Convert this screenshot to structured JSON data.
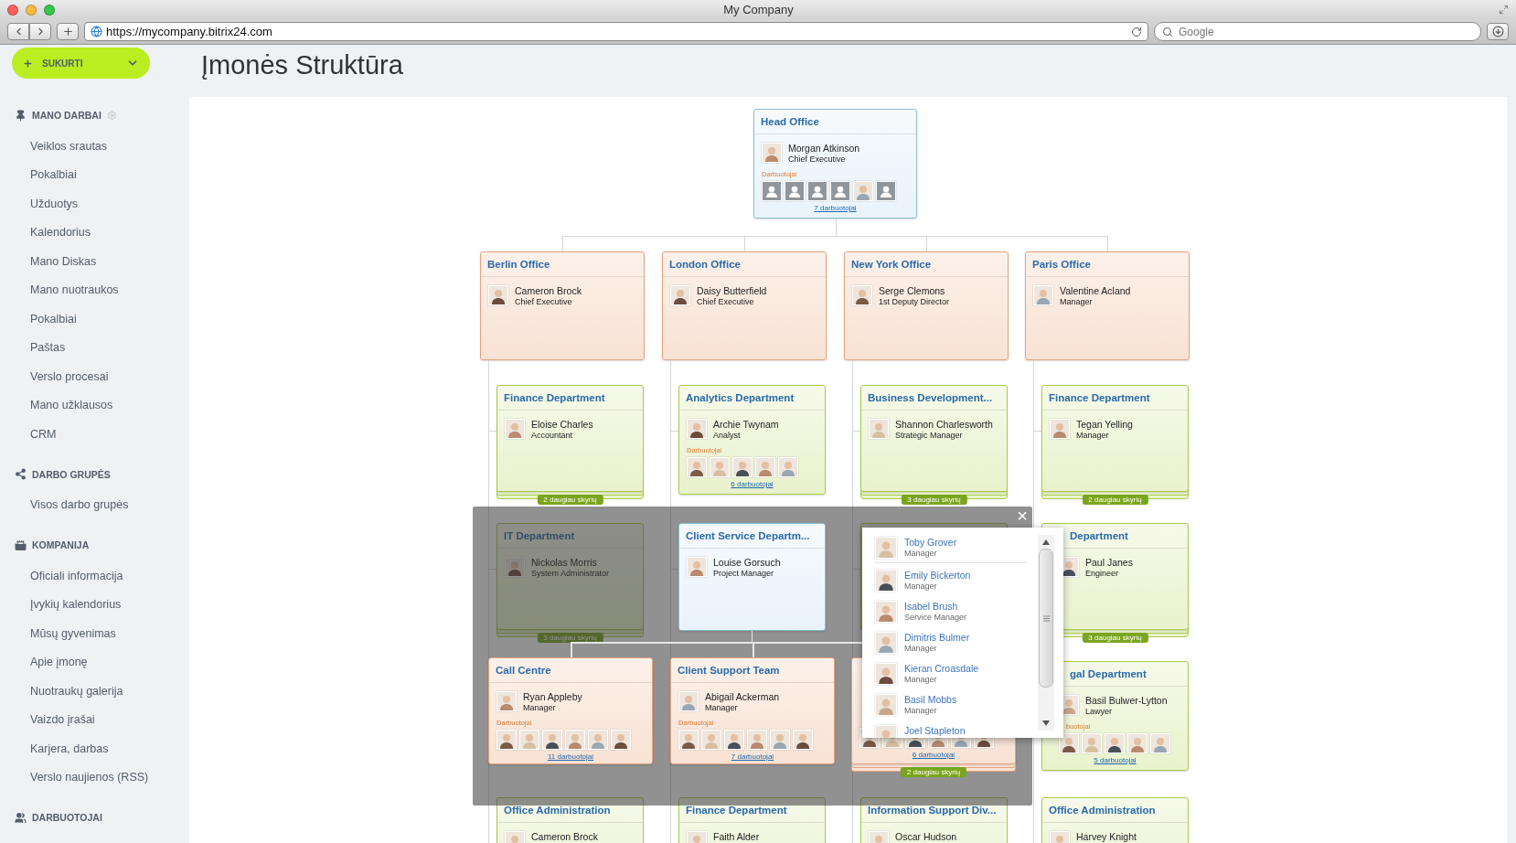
{
  "window": {
    "title": "My Company"
  },
  "browser": {
    "url": "https://mycompany.bitrix24.com",
    "search_placeholder": "Google"
  },
  "create_button": {
    "label": "SUKURTI"
  },
  "sidebar": {
    "sections": [
      {
        "title": "MANO DARBAI",
        "kind": "pin",
        "settings": true,
        "items": [
          "Veiklos srautas",
          "Pokalbiai",
          "Užduotys",
          "Kalendorius",
          "Mano Diskas",
          "Mano nuotraukos",
          "Pokalbiai",
          "Paštas",
          "Verslo procesai",
          "Mano užklausos",
          "CRM"
        ]
      },
      {
        "title": "DARBO GRUPĖS",
        "kind": "share",
        "settings": false,
        "items": [
          "Visos darbo grupės"
        ]
      },
      {
        "title": "KOMPANIJA",
        "kind": "tower",
        "settings": false,
        "items": [
          "Oficiali informacija",
          "Įvykių kalendorius",
          "Mūsų gyvenimas",
          "Apie įmonę",
          "Nuotraukų galerija",
          "Vaizdo įrašai",
          "Karjera, darbas",
          "Verslo naujienos (RSS)"
        ]
      },
      {
        "title": "DARBUOTOJAI",
        "kind": "people",
        "settings": false
      }
    ]
  },
  "page_title": "Įmonės Struktūra",
  "org_chart": {
    "head": {
      "title": "Head Office",
      "person": {
        "name": "Morgan Atkinson",
        "role": "Chief Executive"
      },
      "employees_label": "Darbuotojai",
      "employees": [
        {
          "kind": "placeholder"
        },
        {
          "kind": "placeholder"
        },
        {
          "kind": "placeholder"
        },
        {
          "kind": "placeholder"
        },
        {
          "kind": "photo"
        },
        {
          "kind": "placeholder"
        }
      ],
      "employees_link": "7 darbuotojai"
    },
    "offices": [
      {
        "title": "Berlin Office",
        "person": {
          "name": "Cameron Brock",
          "role": "Chief Executive"
        },
        "departments": [
          {
            "kind": "department",
            "selected": false,
            "title": "Finance Department",
            "person": {
              "name": "Eloise Charles",
              "role": "Accountant"
            },
            "more_badge": "2 daugiau skyrių"
          },
          {
            "kind": "department",
            "selected": false,
            "title": "IT Department",
            "person": {
              "name": "Nickolas Morris",
              "role": "System Administrator"
            },
            "more_badge": "3 daugiau skyrių"
          },
          {
            "kind": "hidden"
          },
          {
            "kind": "department",
            "selected": false,
            "title": "Office Administration",
            "person": {
              "name": "Cameron Brock"
            }
          }
        ]
      },
      {
        "title": "London Office",
        "person": {
          "name": "Daisy Butterfield",
          "role": "Chief Executive"
        },
        "departments": [
          {
            "kind": "department",
            "selected": false,
            "title": "Analytics Department",
            "person": {
              "name": "Archie Twynam",
              "role": "Analyst"
            },
            "employees_label": "Darbuotojai",
            "employees": [
              {
                "kind": "photo"
              },
              {
                "kind": "photo"
              },
              {
                "kind": "photo"
              },
              {
                "kind": "photo"
              },
              {
                "kind": "photo"
              }
            ],
            "employees_link": "6 darbuotojai"
          },
          {
            "kind": "department",
            "selected": true,
            "title": "Client Service Departm...",
            "person": {
              "name": "Louise Gorsuch",
              "role": "Project Manager"
            },
            "children": [
              {
                "kind": "team",
                "title": "Call Centre",
                "person": {
                  "name": "Ryan Appleby",
                  "role": "Manager"
                },
                "employees_label": "Darbuotojai",
                "employees": [
                  {
                    "kind": "photo"
                  },
                  {
                    "kind": "photo"
                  },
                  {
                    "kind": "photo"
                  },
                  {
                    "kind": "photo"
                  },
                  {
                    "kind": "photo"
                  },
                  {
                    "kind": "photo"
                  }
                ],
                "employees_link": "11 darbuotojai"
              },
              {
                "kind": "team",
                "title": "Client Support Team",
                "person": {
                  "name": "Abigail Ackerman",
                  "role": "Manager"
                },
                "employees_label": "Darbuotojai",
                "employees": [
                  {
                    "kind": "photo"
                  },
                  {
                    "kind": "photo"
                  },
                  {
                    "kind": "photo"
                  },
                  {
                    "kind": "photo"
                  },
                  {
                    "kind": "photo"
                  },
                  {
                    "kind": "photo"
                  }
                ],
                "employees_link": "7 darbuotojai"
              },
              {
                "kind": "covered",
                "employees": [
                  {
                    "kind": "photo"
                  },
                  {
                    "kind": "photo"
                  },
                  {
                    "kind": "photo"
                  },
                  {
                    "kind": "photo"
                  },
                  {
                    "kind": "photo"
                  },
                  {
                    "kind": "photo"
                  }
                ],
                "employees_link": "6 darbuotojai",
                "more_badge": "2 daugiau skyrių"
              }
            ]
          },
          {
            "kind": "hidden"
          },
          {
            "kind": "department",
            "selected": false,
            "title": "Finance Department",
            "person": {
              "name": "Faith Alder"
            }
          }
        ]
      },
      {
        "title": "New York Office",
        "person": {
          "name": "Serge Clemons",
          "role": "1st Deputy Director"
        },
        "departments": [
          {
            "kind": "department",
            "selected": false,
            "title": "Business Development...",
            "person": {
              "name": "Shannon Charlesworth",
              "role": "Strategic Manager"
            },
            "more_badge": "3 daugiau skyrių"
          },
          {
            "kind": "covered"
          },
          {
            "kind": "hidden"
          },
          {
            "kind": "department",
            "selected": false,
            "title": "Information Support Div...",
            "person": {
              "name": "Oscar Hudson"
            }
          }
        ]
      },
      {
        "title": "Paris Office",
        "person": {
          "name": "Valentine Acland",
          "role": "Manager"
        },
        "departments": [
          {
            "kind": "department",
            "selected": false,
            "title": "Finance Department",
            "person": {
              "name": "Tegan Yelling",
              "role": "Manager"
            },
            "more_badge": "2 daugiau skyrių"
          },
          {
            "kind": "department",
            "selected": false,
            "partly_hidden": true,
            "title": "Department",
            "person": {
              "name": "Paul Janes",
              "role": "Engineer"
            },
            "more_badge": "3 daugiau skyrių"
          },
          {
            "kind": "department",
            "selected": false,
            "partly_hidden": true,
            "title": "gal Department",
            "person": {
              "name": "Basil Bulwer-Lytton",
              "role": "Lawyer"
            },
            "employees_label": "buotojai",
            "employees": [
              {
                "kind": "photo"
              },
              {
                "kind": "photo"
              },
              {
                "kind": "photo"
              },
              {
                "kind": "photo"
              },
              {
                "kind": "photo"
              }
            ],
            "employees_link": "5 darbuotojai"
          },
          {
            "kind": "department",
            "selected": false,
            "title": "Office Administration",
            "person": {
              "name": "Harvey Knight"
            }
          }
        ]
      }
    ],
    "overlay": {
      "close_label": "×",
      "popup": {
        "items": [
          {
            "name": "Toby Grover",
            "role": "Manager"
          },
          {
            "name": "Emily Bickerton",
            "role": "Manager"
          },
          {
            "name": "Isabel Brush",
            "role": "Service Manager"
          },
          {
            "name": "Dimitris Bulmer",
            "role": "Manager"
          },
          {
            "name": "Kieran Croasdale",
            "role": "Manager"
          },
          {
            "name": "Basil Mobbs",
            "role": "Manager"
          },
          {
            "name": "Joel Stapleton"
          }
        ]
      }
    }
  }
}
